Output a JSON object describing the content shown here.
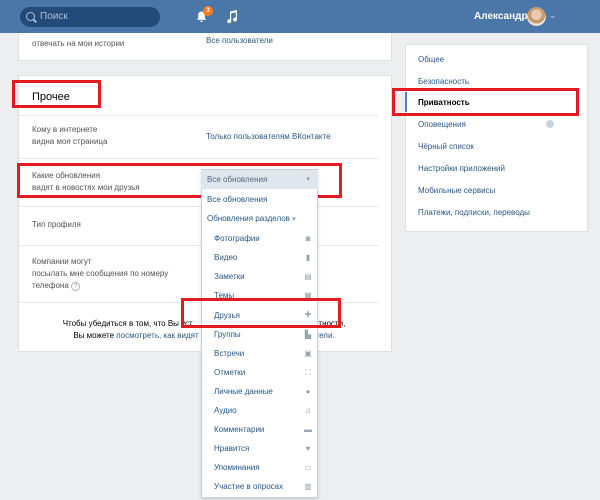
{
  "header": {
    "search_placeholder": "Поиск",
    "notifications_count": "3",
    "username": "Александр"
  },
  "main": {
    "top_partial_label": "отвечать на мои истории",
    "top_partial_value": "Все пользователи",
    "section_title": "Прочее",
    "rows": [
      {
        "label_l1": "Кому в интернете",
        "label_l2": "видна моя страница",
        "value": "Только пользователям ВКонтакте"
      },
      {
        "label_l1": "Какие обновления",
        "label_l2": "видят в новостях мои друзья",
        "value": "Все обновления"
      },
      {
        "label_l1": "Тип профиля",
        "label_l2": "",
        "value": ""
      },
      {
        "label_l1": "Компании могут",
        "label_l2": "посылать мне сообщения по номеру",
        "label_l3": "телефона",
        "value": ""
      }
    ],
    "help_mark": "?",
    "note_line1_a": "Чтобы убедиться в том, что Вы уст",
    "note_line1_b": "приватности,",
    "note_line2_a": "Вы можете ",
    "note_line2_link": "посмотреть, как видят",
    "note_line2_b": "ователи."
  },
  "dropdown": {
    "selected": "Все обновления",
    "option_all": "Все обновления",
    "option_sections": "Обновления разделов",
    "items": [
      {
        "label": "Фотографии",
        "icon": "camera-icon"
      },
      {
        "label": "Видео",
        "icon": "video-icon"
      },
      {
        "label": "Заметки",
        "icon": "notes-icon"
      },
      {
        "label": "Темы",
        "icon": "topics-icon"
      },
      {
        "label": "Друзья",
        "icon": "add-friend-icon"
      },
      {
        "label": "Группы",
        "icon": "groups-icon"
      },
      {
        "label": "Встречи",
        "icon": "events-icon"
      },
      {
        "label": "Отметки",
        "icon": "tags-icon"
      },
      {
        "label": "Личные данные",
        "icon": "person-icon"
      },
      {
        "label": "Аудио",
        "icon": "music-icon"
      },
      {
        "label": "Комментарии",
        "icon": "comment-icon"
      },
      {
        "label": "Нравится",
        "icon": "heart-icon"
      },
      {
        "label": "Упоминания",
        "icon": "mention-icon"
      },
      {
        "label": "Участие в опросах",
        "icon": "poll-icon"
      }
    ]
  },
  "sidebar": {
    "items": [
      "Общее",
      "Безопасность",
      "Приватность",
      "Оповещения",
      "Чёрный список",
      "Настройки приложений",
      "Мобильные сервисы",
      "Платежи, подписки, переводы"
    ],
    "active_index": 2
  },
  "colors": {
    "header": "#4a76a8",
    "link": "#2a5885",
    "highlight": "#e31a22"
  }
}
